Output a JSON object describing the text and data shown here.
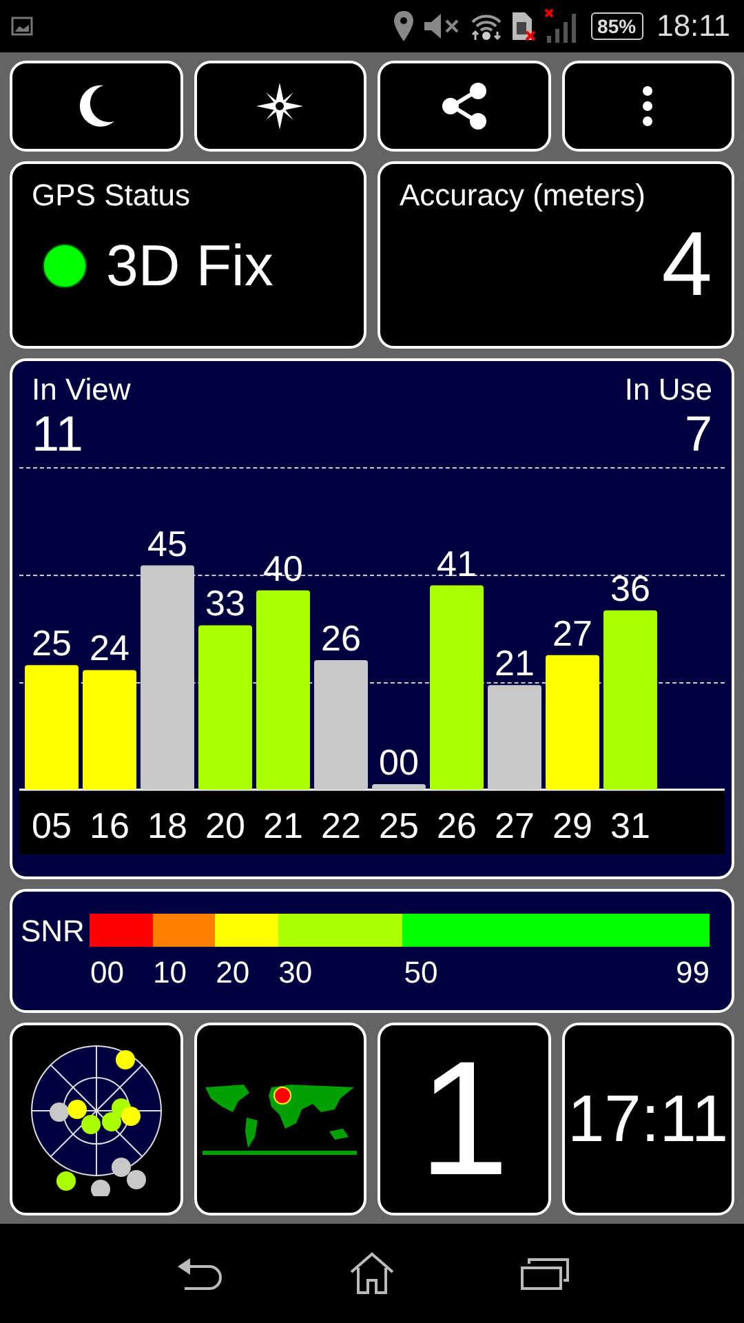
{
  "status_bar": {
    "battery": "85%",
    "time": "18:11"
  },
  "toolbar": [
    {
      "kind": "night"
    },
    {
      "kind": "compass"
    },
    {
      "kind": "share"
    },
    {
      "kind": "more"
    }
  ],
  "gps_status": {
    "label": "GPS Status",
    "value": "3D Fix",
    "fix": true
  },
  "accuracy": {
    "label": "Accuracy (meters)",
    "value": "4"
  },
  "signal_panel": {
    "in_view_label": "In View",
    "in_view": "11",
    "in_use_label": "In Use",
    "in_use": "7",
    "in_use_flags": [
      true,
      true,
      false,
      true,
      true,
      false,
      false,
      true,
      false,
      true,
      true
    ],
    "chart_data": {
      "type": "bar",
      "categories": [
        "05",
        "16",
        "18",
        "20",
        "21",
        "22",
        "25",
        "26",
        "27",
        "29",
        "31"
      ],
      "values": [
        25,
        24,
        45,
        33,
        40,
        26,
        0,
        41,
        21,
        27,
        36
      ],
      "value_labels": [
        "25",
        "24",
        "45",
        "33",
        "40",
        "26",
        "00",
        "41",
        "21",
        "27",
        "36"
      ]
    }
  },
  "snr_legend": {
    "label": "SNR",
    "segments": [
      {
        "label": "00",
        "color": "#ff0000"
      },
      {
        "label": "10",
        "color": "#ff8000"
      },
      {
        "label": "20",
        "color": "#ffff00"
      },
      {
        "label": "30",
        "color": "#aaff00"
      },
      {
        "label": "50",
        "color": "#00ff00"
      }
    ],
    "max_label": "99"
  },
  "bottom_tiles": [
    {
      "kind": "skyplot"
    },
    {
      "kind": "map"
    },
    {
      "kind": "count",
      "value": "1"
    },
    {
      "kind": "clock",
      "value": "17:11"
    }
  ]
}
